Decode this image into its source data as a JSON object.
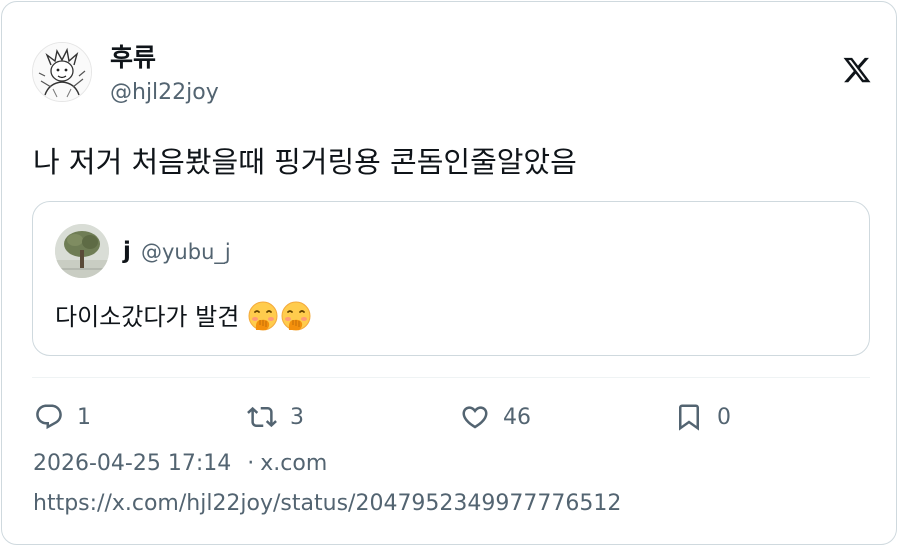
{
  "author": {
    "display_name": "후류",
    "handle": "@hjl22joy",
    "avatar_icon": "sketch-character-avatar"
  },
  "platform": {
    "logo_icon": "x-logo-icon"
  },
  "tweet": {
    "text": "나 저거 처음봤을때 핑거링용 콘돔인줄알았음"
  },
  "quote": {
    "display_name": "j",
    "handle": "@yubu_j",
    "avatar_icon": "tree-photo-avatar",
    "text": "다이소갔다가 발견",
    "emojis": [
      "face-with-hand-over-mouth",
      "face-with-hand-over-mouth"
    ]
  },
  "actions": {
    "reply_count": "1",
    "retweet_count": "3",
    "like_count": "46",
    "bookmark_count": "0"
  },
  "meta": {
    "timestamp": "2026-04-25 17:14",
    "separator": "·",
    "source": "x.com",
    "url": "https://x.com/hjl22joy/status/2047952349977776512"
  },
  "colors": {
    "text_primary": "#0f1419",
    "text_secondary": "#536471",
    "border": "#cfd9de"
  }
}
